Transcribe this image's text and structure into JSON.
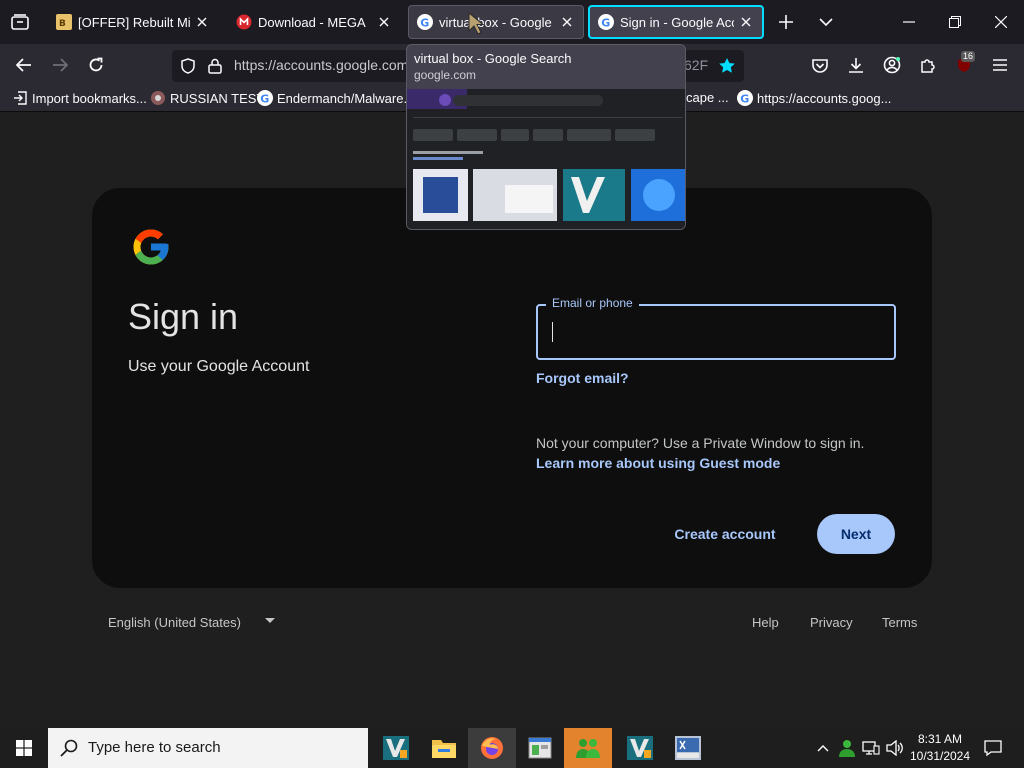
{
  "tabs": [
    {
      "title": "[OFFER] Rebuilt Microsoft",
      "favicon": "forum-icon"
    },
    {
      "title": "Download - MEGA",
      "favicon": "mega-icon"
    },
    {
      "title": "virtual box - Google Search",
      "favicon": "google-icon"
    },
    {
      "title": "Sign in - Google Accounts",
      "favicon": "google-icon"
    }
  ],
  "nav": {
    "url": "https://accounts.google.com",
    "url_tail": "62F",
    "extension_badge": "16"
  },
  "bookmarks": [
    {
      "label": "Import bookmarks..."
    },
    {
      "label": "RUSSIAN TEST"
    },
    {
      "label": "Endermanch/Malware..."
    },
    {
      "label": "cape ..."
    },
    {
      "label": "https://accounts.goog..."
    }
  ],
  "preview": {
    "title": "virtual box - Google Search",
    "host": "google.com"
  },
  "signin": {
    "title": "Sign in",
    "subtitle": "Use your Google Account",
    "email_label": "Email or phone",
    "forgot": "Forgot email?",
    "not_your_computer": "Not your computer? Use a Private Window to sign in.",
    "learn_more": "Learn more about using Guest mode",
    "create_account": "Create account",
    "next": "Next"
  },
  "footer": {
    "language": "English (United States)",
    "help": "Help",
    "privacy": "Privacy",
    "terms": "Terms"
  },
  "taskbar": {
    "search_placeholder": "Type here to search",
    "time": "8:31 AM",
    "date": "10/31/2024"
  },
  "colors": {
    "accent": "#a8c7fa",
    "selected_tab_border": "#00ddff",
    "card_bg": "#0e0e0e"
  }
}
